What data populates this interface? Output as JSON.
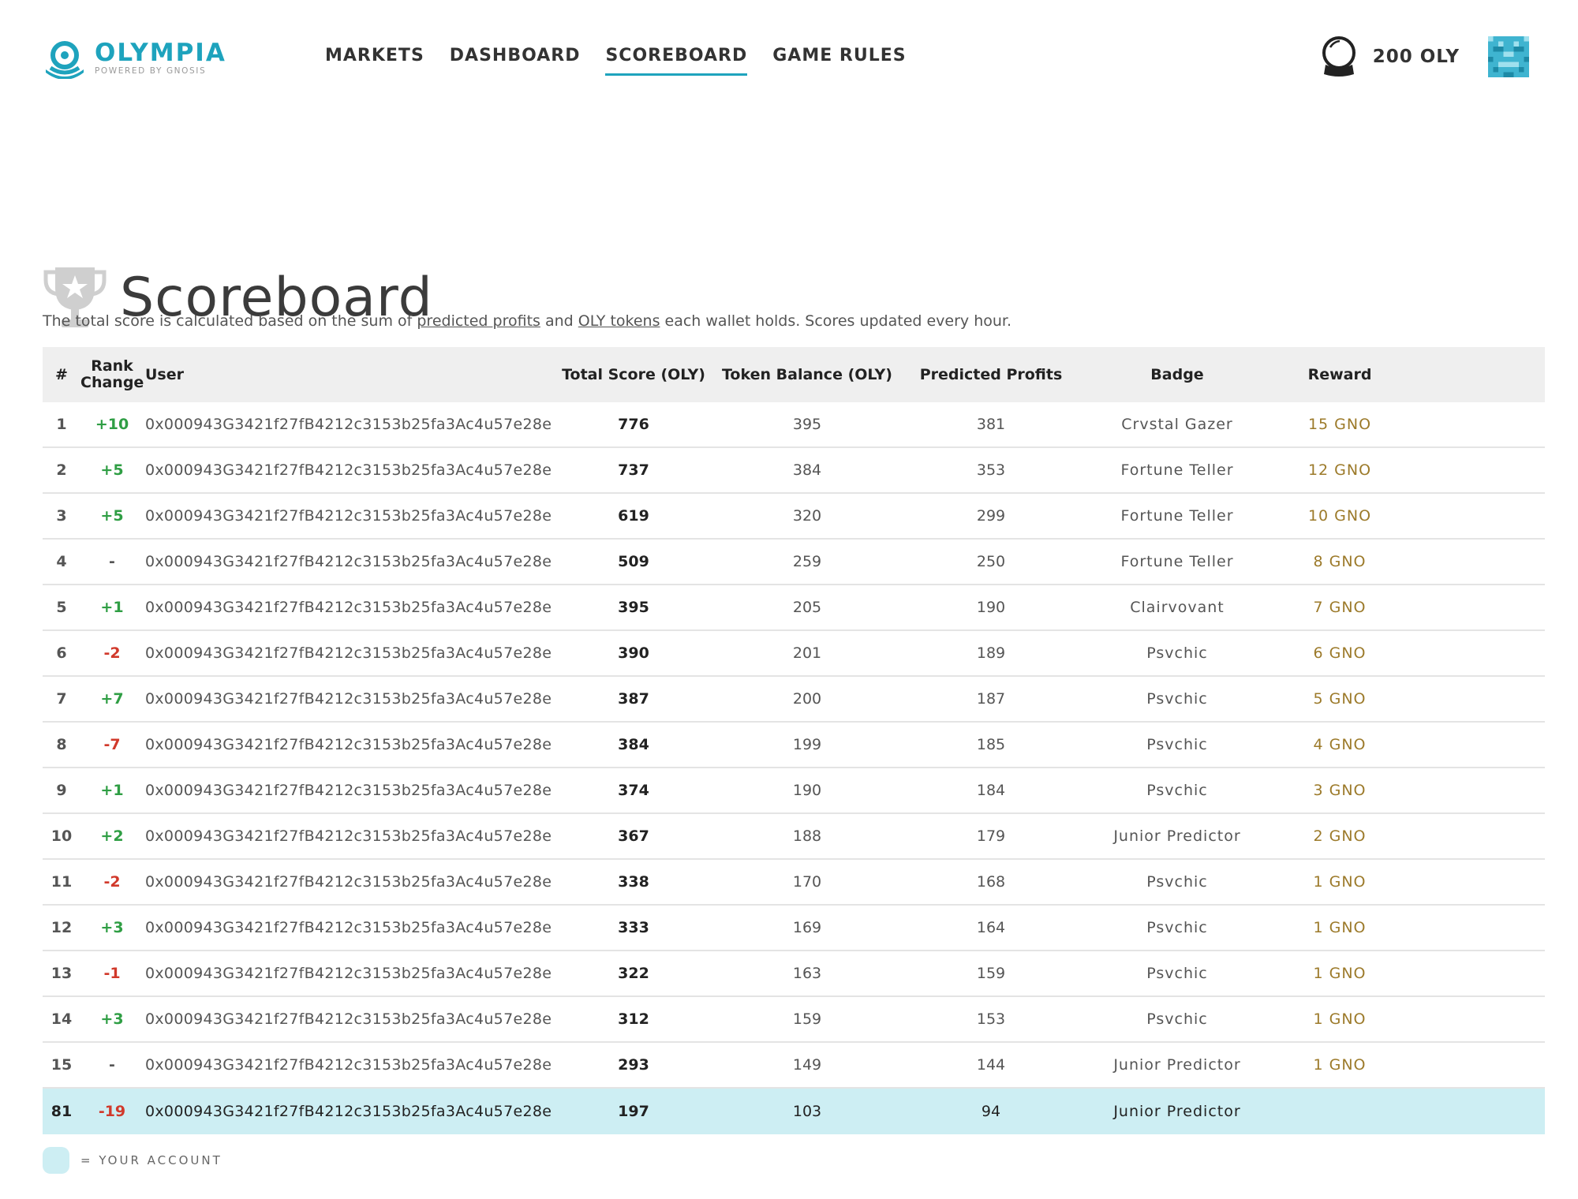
{
  "header": {
    "logo_name": "OLYMPIA",
    "logo_sub": "POWERED BY GNOSIS",
    "nav": [
      {
        "label": "MARKETS"
      },
      {
        "label": "DASHBOARD"
      },
      {
        "label": "SCOREBOARD"
      },
      {
        "label": "GAME RULES"
      }
    ],
    "active_nav": "SCOREBOARD",
    "balance": "200 OLY"
  },
  "page": {
    "title": "Scoreboard",
    "desc_prefix": "The total score is calculated based on the sum of",
    "desc_link1": "predicted profits",
    "desc_mid": "and",
    "desc_link2": "OLY tokens",
    "desc_suffix": "each wallet holds. Scores updated every hour."
  },
  "table": {
    "headers": {
      "rank": "#",
      "rank_change_1": "Rank",
      "rank_change_2": "Change",
      "user": "User",
      "total": "Total Score (OLY)",
      "token": "Token Balance (OLY)",
      "profits": "Predicted Profits",
      "badge": "Badge",
      "reward": "Reward"
    },
    "rows": [
      {
        "rank": "1",
        "change": "+10",
        "user": "0x000943G3421f27fB4212c3153b25fa3Ac4u57e28e",
        "total": "776",
        "token": "395",
        "profits": "381",
        "badge": "Crvstal Gazer",
        "reward": "15 GNO"
      },
      {
        "rank": "2",
        "change": "+5",
        "user": "0x000943G3421f27fB4212c3153b25fa3Ac4u57e28e",
        "total": "737",
        "token": "384",
        "profits": "353",
        "badge": "Fortune Teller",
        "reward": "12 GNO"
      },
      {
        "rank": "3",
        "change": "+5",
        "user": "0x000943G3421f27fB4212c3153b25fa3Ac4u57e28e",
        "total": "619",
        "token": "320",
        "profits": "299",
        "badge": "Fortune Teller",
        "reward": "10 GNO"
      },
      {
        "rank": "4",
        "change": "-",
        "user": "0x000943G3421f27fB4212c3153b25fa3Ac4u57e28e",
        "total": "509",
        "token": "259",
        "profits": "250",
        "badge": "Fortune Teller",
        "reward": "8 GNO"
      },
      {
        "rank": "5",
        "change": "+1",
        "user": "0x000943G3421f27fB4212c3153b25fa3Ac4u57e28e",
        "total": "395",
        "token": "205",
        "profits": "190",
        "badge": "Clairvovant",
        "reward": "7 GNO"
      },
      {
        "rank": "6",
        "change": "-2",
        "user": "0x000943G3421f27fB4212c3153b25fa3Ac4u57e28e",
        "total": "390",
        "token": "201",
        "profits": "189",
        "badge": "Psvchic",
        "reward": "6 GNO"
      },
      {
        "rank": "7",
        "change": "+7",
        "user": "0x000943G3421f27fB4212c3153b25fa3Ac4u57e28e",
        "total": "387",
        "token": "200",
        "profits": "187",
        "badge": "Psvchic",
        "reward": "5 GNO"
      },
      {
        "rank": "8",
        "change": "-7",
        "user": "0x000943G3421f27fB4212c3153b25fa3Ac4u57e28e",
        "total": "384",
        "token": "199",
        "profits": "185",
        "badge": "Psvchic",
        "reward": "4 GNO"
      },
      {
        "rank": "9",
        "change": "+1",
        "user": "0x000943G3421f27fB4212c3153b25fa3Ac4u57e28e",
        "total": "374",
        "token": "190",
        "profits": "184",
        "badge": "Psvchic",
        "reward": "3 GNO"
      },
      {
        "rank": "10",
        "change": "+2",
        "user": "0x000943G3421f27fB4212c3153b25fa3Ac4u57e28e",
        "total": "367",
        "token": "188",
        "profits": "179",
        "badge": "Junior Predictor",
        "reward": "2 GNO"
      },
      {
        "rank": "11",
        "change": "-2",
        "user": "0x000943G3421f27fB4212c3153b25fa3Ac4u57e28e",
        "total": "338",
        "token": "170",
        "profits": "168",
        "badge": "Psvchic",
        "reward": "1 GNO"
      },
      {
        "rank": "12",
        "change": "+3",
        "user": "0x000943G3421f27fB4212c3153b25fa3Ac4u57e28e",
        "total": "333",
        "token": "169",
        "profits": "164",
        "badge": "Psvchic",
        "reward": "1 GNO"
      },
      {
        "rank": "13",
        "change": "-1",
        "user": "0x000943G3421f27fB4212c3153b25fa3Ac4u57e28e",
        "total": "322",
        "token": "163",
        "profits": "159",
        "badge": "Psvchic",
        "reward": "1 GNO"
      },
      {
        "rank": "14",
        "change": "+3",
        "user": "0x000943G3421f27fB4212c3153b25fa3Ac4u57e28e",
        "total": "312",
        "token": "159",
        "profits": "153",
        "badge": "Psvchic",
        "reward": "1 GNO"
      },
      {
        "rank": "15",
        "change": "-",
        "user": "0x000943G3421f27fB4212c3153b25fa3Ac4u57e28e",
        "total": "293",
        "token": "149",
        "profits": "144",
        "badge": "Junior Predictor",
        "reward": "1 GNO"
      }
    ],
    "you": {
      "rank": "81",
      "change": "-19",
      "user": "0x000943G3421f27fB4212c3153b25fa3Ac4u57e28e",
      "total": "197",
      "token": "103",
      "profits": "94",
      "badge": "Junior Predictor",
      "reward": ""
    }
  },
  "legend": {
    "text": "= YOUR ACCOUNT"
  },
  "colors": {
    "accent": "#1ea3bd",
    "positive": "#2f9e44",
    "negative": "#d1392b",
    "reward": "#9c7a2a",
    "highlight_row": "#cdeef3",
    "header_bg": "#efefef"
  },
  "icons": {
    "logo": "olympia-logo-icon",
    "balance": "crystal-ball-icon",
    "avatar": "pixel-avatar-icon",
    "title": "trophy-icon"
  }
}
